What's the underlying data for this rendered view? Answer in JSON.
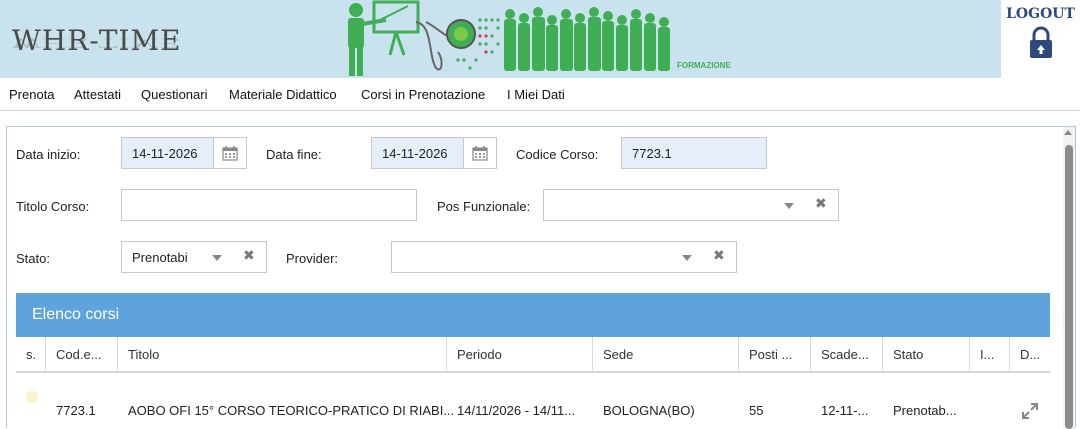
{
  "app": {
    "title": "WHR-TIME",
    "banner_caption": "FORMAZIONE",
    "logout_label": "LOGOUT"
  },
  "menu": [
    {
      "label": "Prenota"
    },
    {
      "label": "Attestati"
    },
    {
      "label": "Questionari"
    },
    {
      "label": "Materiale Didattico"
    },
    {
      "label": "Corsi in Prenotazione"
    },
    {
      "label": "I Miei Dati"
    }
  ],
  "filters": {
    "data_inizio": {
      "label": "Data inizio:",
      "value": "14-11-2026"
    },
    "data_fine": {
      "label": "Data fine:",
      "value": "14-11-2026"
    },
    "codice_corso": {
      "label": "Codice Corso:",
      "value": "7723.1"
    },
    "titolo_corso": {
      "label": "Titolo Corso:",
      "value": ""
    },
    "pos_funzionale": {
      "label": "Pos Funzionale:",
      "value": ""
    },
    "stato": {
      "label": "Stato:",
      "value": "Prenotabi"
    },
    "provider": {
      "label": "Provider:",
      "value": ""
    }
  },
  "grid": {
    "title": "Elenco corsi",
    "columns": [
      "s.",
      "Cod.e...",
      "Titolo",
      "Periodo",
      "Sede",
      "Posti ...",
      "Scade...",
      "Stato",
      "I...",
      "D..."
    ],
    "rows": [
      {
        "cod": "7723.1",
        "titolo": "AOBO OFI 15° CORSO TEORICO-PRATICO DI RIABI...",
        "periodo": "14/11/2026 - 14/11...",
        "sede": "BOLOGNA(BO)",
        "posti": "55",
        "scadenza": "12-11-...",
        "stato": "Prenotab..."
      }
    ]
  },
  "colors": {
    "banner_bg": "#c9e3ee",
    "grid_header_bg": "#5fa3dc",
    "filled_field_bg": "#e6eefa",
    "figure_green": "#3fae55",
    "logout_blue": "#2d4a7a"
  }
}
